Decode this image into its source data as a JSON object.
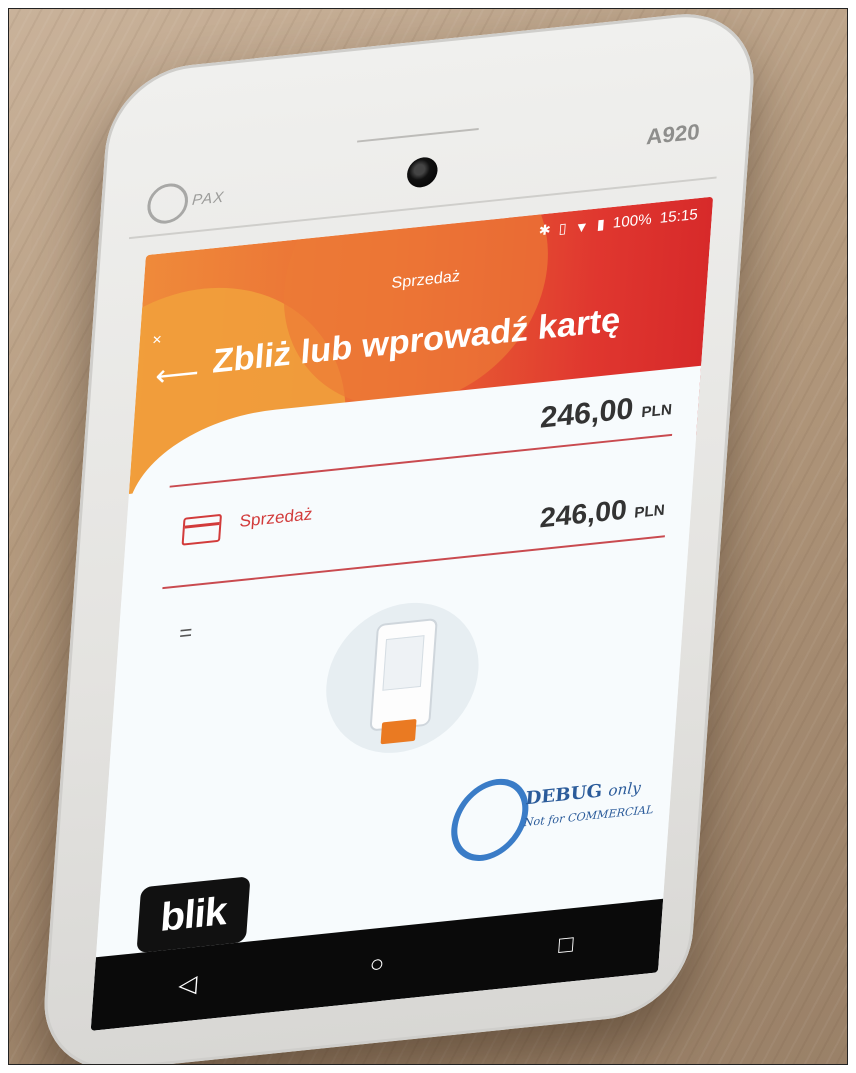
{
  "device": {
    "model": "A920",
    "brand": "PAX"
  },
  "status_bar": {
    "battery": "100%",
    "time": "15:15"
  },
  "header": {
    "subtitle": "Sprzedaż",
    "title": "Zbliż lub wprowadź kartę"
  },
  "transaction": {
    "total_amount": "246,00",
    "total_currency": "PLN",
    "line_label": "Sprzedaż",
    "line_amount": "246,00",
    "line_currency": "PLN",
    "equals": "="
  },
  "debug_watermark": {
    "title": "DEBUG",
    "title_suffix": "only",
    "subtitle": "Not for COMMERCIAL"
  },
  "payment_logo": {
    "text": "blik"
  },
  "navigation": {
    "back": "◁",
    "home": "○",
    "recents": "□"
  },
  "icons": [
    "bluetooth-icon",
    "vibrate-icon",
    "wifi-icon",
    "battery-icon",
    "back-arrow-icon",
    "card-icon",
    "terminal-illustration"
  ]
}
